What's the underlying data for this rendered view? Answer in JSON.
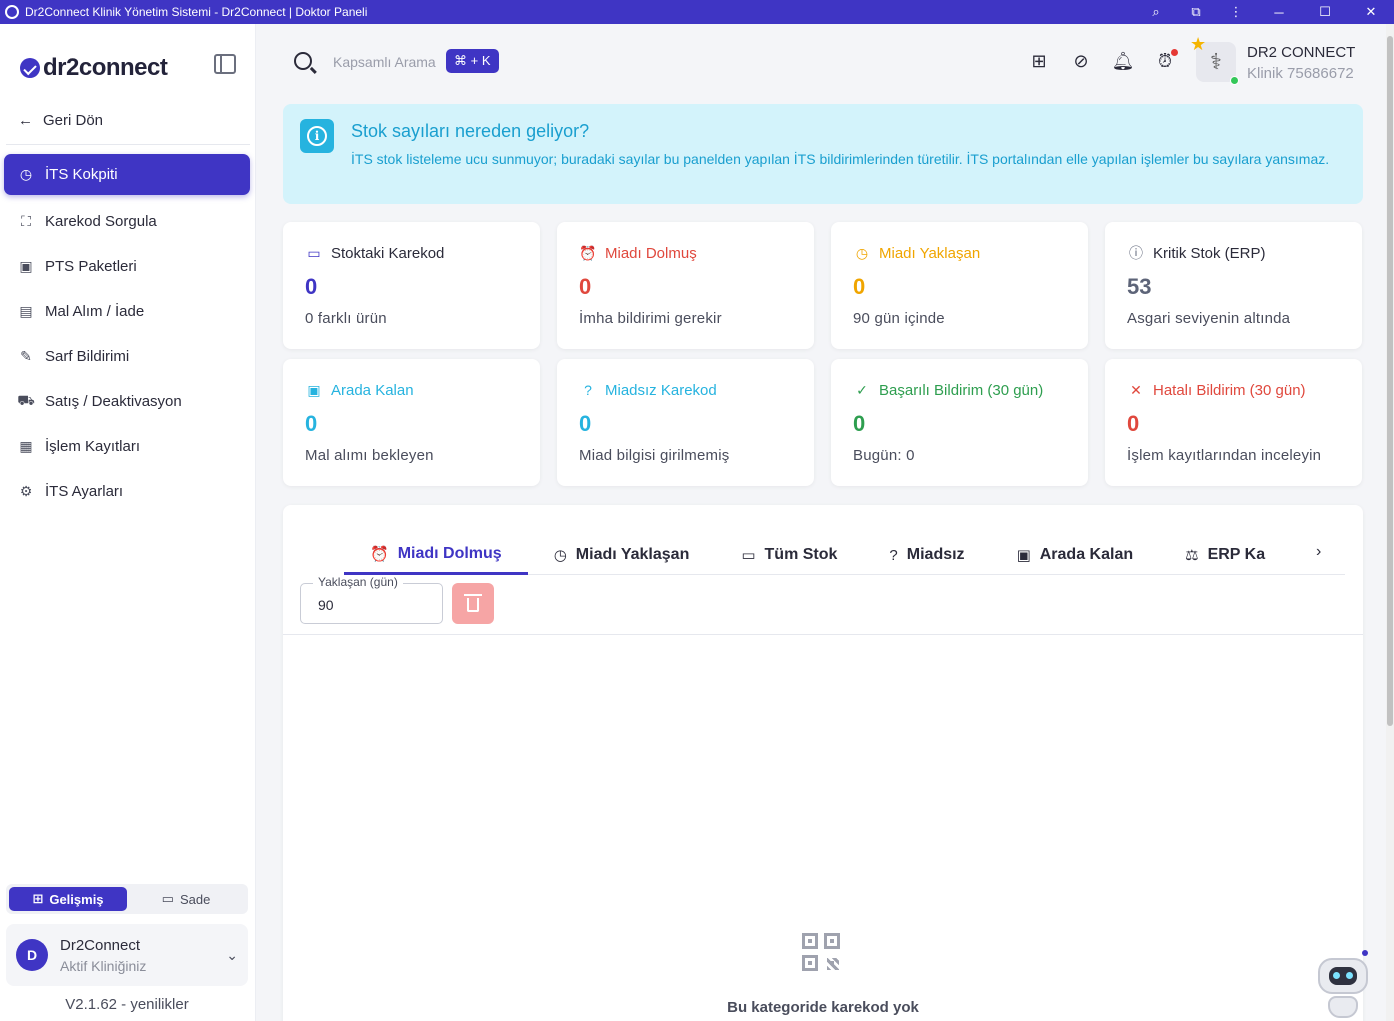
{
  "window": {
    "title": "Dr2Connect Klinik Yönetim Sistemi - Dr2Connect | Doktor Paneli",
    "buttons": {
      "zoom": "⌕",
      "extensions": "⧉",
      "menu": "⋮",
      "minimize": "─",
      "maximize": "☐",
      "close": "✕"
    }
  },
  "sidebar": {
    "logo_text": "dr2connect",
    "back_label": "Geri Dön",
    "items": [
      {
        "label": "İTS Kokpiti",
        "icon": "gauge-icon",
        "glyph": "◷",
        "active": true
      },
      {
        "label": "Karekod Sorgula",
        "icon": "scan-icon",
        "glyph": "⛶"
      },
      {
        "label": "PTS Paketleri",
        "icon": "package-icon",
        "glyph": "▣"
      },
      {
        "label": "Mal Alım / İade",
        "icon": "box-in-icon",
        "glyph": "▤"
      },
      {
        "label": "Sarf Bildirimi",
        "icon": "syringe-icon",
        "glyph": "✎"
      },
      {
        "label": "Satış / Deaktivasyon",
        "icon": "truck-icon",
        "glyph": "⛟"
      },
      {
        "label": "İşlem Kayıtları",
        "icon": "log-icon",
        "glyph": "▦"
      },
      {
        "label": "İTS Ayarları",
        "icon": "settings-icon",
        "glyph": "⚙"
      }
    ],
    "mode": {
      "advanced": "Gelişmiş",
      "simple": "Sade"
    },
    "clinic": {
      "initial": "D",
      "name": "Dr2Connect",
      "sub": "Aktif Kliniğiniz"
    },
    "version": "V2.1.62 - yenilikler"
  },
  "topbar": {
    "search_placeholder": "Kapsamlı Arama",
    "shortcut": "⌘ + K",
    "user_name": "DR2 CONNECT",
    "user_sub": "Klinik 75686672"
  },
  "alert": {
    "title": "Stok sayıları nereden geliyor?",
    "text": "İTS stok listeleme ucu sunmuyor; buradaki sayılar bu panelden yapılan İTS bildirimlerinden türetilir. İTS portalından elle yapılan işlemler bu sayılara yansımaz."
  },
  "colors": {
    "primary": "#3f35c4",
    "danger": "#e0483d",
    "warning": "#f0a500",
    "gray": "#5d6478",
    "info": "#26b3df",
    "success": "#2e9e4f"
  },
  "cards": [
    {
      "title": "Stoktaki Karekod",
      "value": "0",
      "sub": "0 farklı ürün",
      "color": "#3f35c4",
      "glyph": "▭",
      "icon": "archive-icon"
    },
    {
      "title": "Miadı Dolmuş",
      "value": "0",
      "sub": "İmha bildirimi gerekir",
      "color": "#e0483d",
      "glyph": "⏰",
      "icon": "alarm-icon"
    },
    {
      "title": "Miadı Yaklaşan",
      "value": "0",
      "sub": "90 gün içinde",
      "color": "#f0a500",
      "glyph": "◷",
      "icon": "clock-icon"
    },
    {
      "title": "Kritik Stok (ERP)",
      "value": "53",
      "sub": "Asgari seviyenin altında",
      "color": "#5d6478",
      "glyph": "ⓘ",
      "icon": "alert-circle-icon"
    },
    {
      "title": "Arada Kalan",
      "value": "0",
      "sub": "Mal alımı bekleyen",
      "color": "#26b3df",
      "glyph": "▣",
      "icon": "box-pending-icon"
    },
    {
      "title": "Miadsız Karekod",
      "value": "0",
      "sub": "Miad bilgisi girilmemiş",
      "color": "#26b3df",
      "glyph": "?",
      "icon": "question-icon"
    },
    {
      "title": "Başarılı Bildirim (30 gün)",
      "value": "0",
      "sub": "Bugün: 0",
      "color": "#2e9e4f",
      "glyph": "✓",
      "icon": "check-circle-icon"
    },
    {
      "title": "Hatalı Bildirim (30 gün)",
      "value": "0",
      "sub": "İşlem kayıtlarından inceleyin",
      "color": "#e0483d",
      "glyph": "✕",
      "icon": "x-circle-icon"
    }
  ],
  "tabs": [
    {
      "label": "Miadı Dolmuş",
      "glyph": "⏰",
      "icon": "alarm-icon",
      "active": true
    },
    {
      "label": "Miadı Yaklaşan",
      "glyph": "◷",
      "icon": "clock-icon"
    },
    {
      "label": "Tüm Stok",
      "glyph": "▭",
      "icon": "archive-icon"
    },
    {
      "label": "Miadsız",
      "glyph": "?",
      "icon": "question-icon"
    },
    {
      "label": "Arada Kalan",
      "glyph": "▣",
      "icon": "box-pending-icon"
    },
    {
      "label": "ERP Ka",
      "glyph": "⚖",
      "icon": "scale-icon"
    }
  ],
  "filter": {
    "label": "Yaklaşan (gün)",
    "value": "90"
  },
  "empty_state": "Bu kategoride karekod yok"
}
